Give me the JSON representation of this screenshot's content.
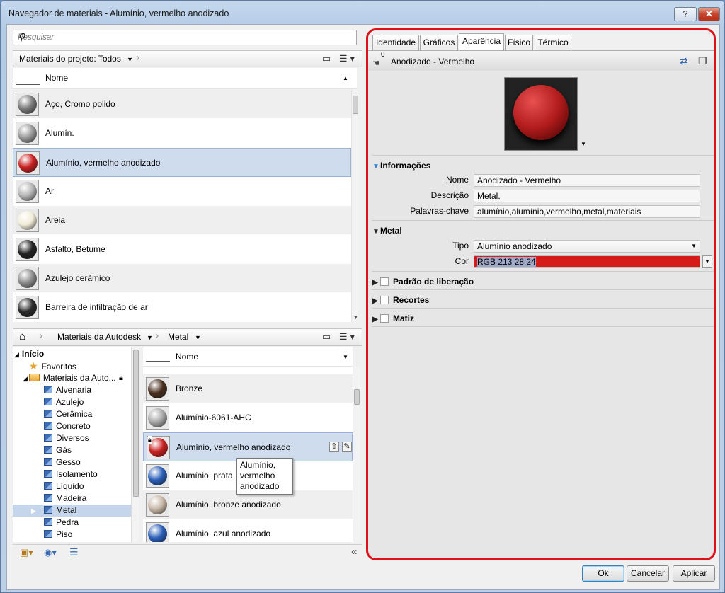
{
  "window": {
    "title": "Navegador de materiais - Alumínio, vermelho anodizado",
    "help": "?",
    "close": "✕"
  },
  "search": {
    "placeholder": "Pesquisar"
  },
  "project": {
    "crumb": "Materiais do projeto: Todos",
    "column": "Nome",
    "items": [
      {
        "name": "Aço, Cromo polido",
        "color": "#7a7a7a"
      },
      {
        "name": "Alumín.",
        "color": "#9a9a9a"
      },
      {
        "name": "Alumínio, vermelho anodizado",
        "color": "#c82020"
      },
      {
        "name": "Ar",
        "color": "#b5b5b5"
      },
      {
        "name": "Areia",
        "color": "#f1ecd8"
      },
      {
        "name": "Asfalto, Betume",
        "color": "#222222"
      },
      {
        "name": "Azulejo cerâmico",
        "color": "#8c8c8c"
      },
      {
        "name": "Barreira de infiltração de ar",
        "color": "#2b2b2b"
      }
    ]
  },
  "library": {
    "crumb_home": "⌂",
    "crumb1": "Materiais da Autodesk",
    "crumb2": "Metal",
    "column": "Nome",
    "tree": [
      {
        "label": "Início",
        "bold": true,
        "indent": 0,
        "type": "root"
      },
      {
        "label": "Favoritos",
        "indent": 1,
        "type": "star"
      },
      {
        "label": "Materiais da Auto...",
        "indent": 1,
        "type": "folder"
      },
      {
        "label": "Alvenaria",
        "indent": 2,
        "type": "lib"
      },
      {
        "label": "Azulejo",
        "indent": 2,
        "type": "lib"
      },
      {
        "label": "Cerâmica",
        "indent": 2,
        "type": "lib"
      },
      {
        "label": "Concreto",
        "indent": 2,
        "type": "lib"
      },
      {
        "label": "Diversos",
        "indent": 2,
        "type": "lib"
      },
      {
        "label": "Gás",
        "indent": 2,
        "type": "lib"
      },
      {
        "label": "Gesso",
        "indent": 2,
        "type": "lib"
      },
      {
        "label": "Isolamento",
        "indent": 2,
        "type": "lib"
      },
      {
        "label": "Líquido",
        "indent": 2,
        "type": "lib"
      },
      {
        "label": "Madeira",
        "indent": 2,
        "type": "lib"
      },
      {
        "label": "Metal",
        "indent": 2,
        "type": "lib",
        "selected": true
      },
      {
        "label": "Pedra",
        "indent": 2,
        "type": "lib"
      },
      {
        "label": "Piso",
        "indent": 2,
        "type": "lib"
      }
    ],
    "items": [
      {
        "name": "Bronze",
        "color": "#4a3020"
      },
      {
        "name": "Alumínio-6061-AHC",
        "color": "#a8a8a8"
      },
      {
        "name": "Alumínio, vermelho anodizado",
        "color": "#c82020",
        "selected": true
      },
      {
        "name": "Alumínio, prata",
        "color": "#2a5fb8"
      },
      {
        "name": "Alumínio, bronze anodizado",
        "color": "#c8b8a8"
      },
      {
        "name": "Alumínio, azul anodizado",
        "color": "#2a5fb8"
      }
    ],
    "tooltip": "Alumínio, vermelho anodizado"
  },
  "editor": {
    "tabs": [
      "Identidade",
      "Gráficos",
      "Aparência",
      "Físico",
      "Térmico"
    ],
    "active_tab": 2,
    "asset_count": "0",
    "asset_name": "Anodizado - Vermelho",
    "info": {
      "header": "Informações",
      "name_label": "Nome",
      "name_value": "Anodizado - Vermelho",
      "desc_label": "Descrição",
      "desc_value": "Metal.",
      "kw_label": "Palavras-chave",
      "kw_value": "alumínio,alumínio,vermelho,metal,materiais"
    },
    "metal": {
      "header": "Metal",
      "type_label": "Tipo",
      "type_value": "Alumínio anodizado",
      "color_label": "Cor",
      "color_value": "RGB 213 28 24",
      "color_hex": "#d51c18"
    },
    "sections": [
      "Padrão de liberação",
      "Recortes",
      "Matiz"
    ]
  },
  "buttons": {
    "ok": "Ok",
    "cancel": "Cancelar",
    "apply": "Aplicar"
  }
}
